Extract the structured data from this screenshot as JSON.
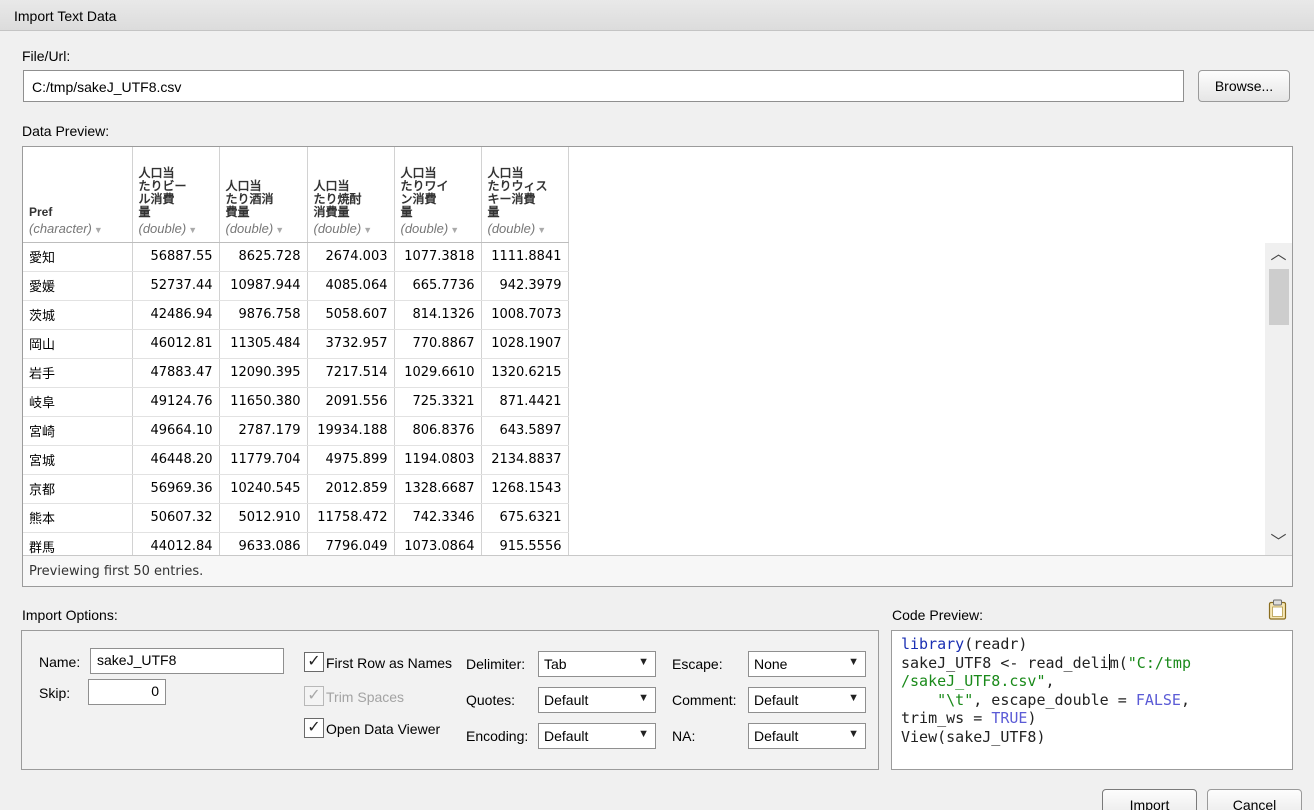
{
  "window": {
    "title": "Import Text Data"
  },
  "file": {
    "label": "File/Url:",
    "value": "C:/tmp/sakeJ_UTF8.csv",
    "browse_label": "Browse..."
  },
  "preview": {
    "label": "Data Preview:",
    "columns": [
      {
        "title": "Pref",
        "type": "(character)"
      },
      {
        "title": "人口当\nたりビー\nル消費\n量",
        "type": "(double)"
      },
      {
        "title": "人口当\nたり酒消\n費量",
        "type": "(double)"
      },
      {
        "title": "人口当\nたり焼酎\n消費量",
        "type": "(double)"
      },
      {
        "title": "人口当\nたりワイ\nン消費\n量",
        "type": "(double)"
      },
      {
        "title": "人口当\nたりウィス\nキー消費\n量",
        "type": "(double)"
      }
    ],
    "rows": [
      [
        "愛知",
        "56887.55",
        "8625.728",
        "2674.003",
        "1077.3818",
        "1111.8841"
      ],
      [
        "愛媛",
        "52737.44",
        "10987.944",
        "4085.064",
        "665.7736",
        "942.3979"
      ],
      [
        "茨城",
        "42486.94",
        "9876.758",
        "5058.607",
        "814.1326",
        "1008.7073"
      ],
      [
        "岡山",
        "46012.81",
        "11305.484",
        "3732.957",
        "770.8867",
        "1028.1907"
      ],
      [
        "岩手",
        "47883.47",
        "12090.395",
        "7217.514",
        "1029.6610",
        "1320.6215"
      ],
      [
        "岐阜",
        "49124.76",
        "11650.380",
        "2091.556",
        "725.3321",
        "871.4421"
      ],
      [
        "宮崎",
        "49664.10",
        "2787.179",
        "19934.188",
        "806.8376",
        "643.5897"
      ],
      [
        "宮城",
        "46448.20",
        "11779.704",
        "4975.899",
        "1194.0803",
        "2134.8837"
      ],
      [
        "京都",
        "56969.36",
        "10240.545",
        "2012.859",
        "1328.6687",
        "1268.1543"
      ],
      [
        "熊本",
        "50607.32",
        "5012.910",
        "11758.472",
        "742.3346",
        "675.6321"
      ],
      [
        "群馬",
        "44012.84",
        "9633.086",
        "7796.049",
        "1073.0864",
        "915.5556"
      ]
    ],
    "footer": "Previewing first 50 entries."
  },
  "options": {
    "label": "Import Options:",
    "name_label": "Name:",
    "name_value": "sakeJ_UTF8",
    "skip_label": "Skip:",
    "skip_value": "0",
    "first_row_label": "First Row as Names",
    "trim_label": "Trim Spaces",
    "open_viewer_label": "Open Data Viewer",
    "delimiter_label": "Delimiter:",
    "delimiter_value": "Tab",
    "quotes_label": "Quotes:",
    "quotes_value": "Default",
    "encoding_label": "Encoding:",
    "encoding_value": "Default",
    "escape_label": "Escape:",
    "escape_value": "None",
    "comment_label": "Comment:",
    "comment_value": "Default",
    "na_label": "NA:",
    "na_value": "Default"
  },
  "code": {
    "label": "Code Preview:",
    "l1_fn": "library",
    "l1_rest": "(readr)",
    "l2_a": "sakeJ_UTF8 <- read_deli",
    "l2_b": "m(",
    "l2_str": "\"C:/tmp",
    "l3_str": "/sakeJ_UTF8.csv\"",
    "l3_rest": ",",
    "l4_pre": "    ",
    "l4_str": "\"\\t\"",
    "l4_mid": ", escape_double = ",
    "l4_const": "FALSE",
    "l4_end": ",",
    "l5_a": "trim_ws = ",
    "l5_const": "TRUE",
    "l5_end": ")",
    "l6": "View(sakeJ_UTF8)"
  },
  "buttons": {
    "import": "Import",
    "cancel": "Cancel"
  }
}
